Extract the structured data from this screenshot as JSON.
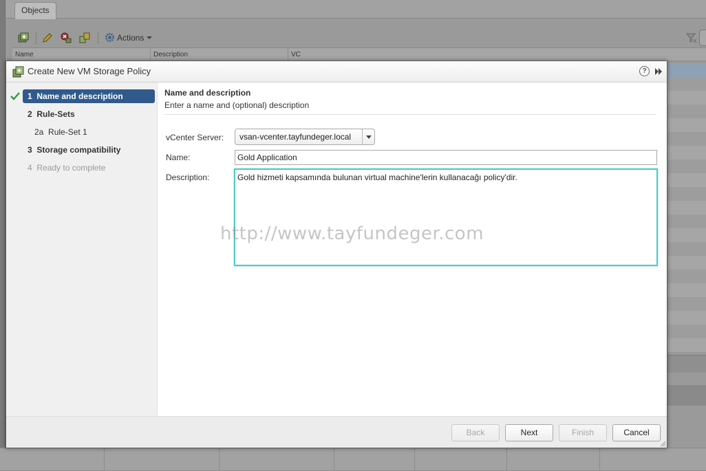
{
  "background": {
    "tab_label": "Objects",
    "toolbar": {
      "actions_label": "Actions"
    },
    "table_columns": [
      "Name",
      "Description",
      "VC"
    ]
  },
  "dialog": {
    "title": "Create New VM Storage Policy",
    "help_label": "?",
    "steps": [
      {
        "number": "1",
        "label": "Name and description",
        "state": "active"
      },
      {
        "number": "2",
        "label": "Rule-Sets",
        "state": "normal"
      },
      {
        "number": "2a",
        "label": "Rule-Set 1",
        "state": "sub"
      },
      {
        "number": "3",
        "label": "Storage compatibility",
        "state": "normal"
      },
      {
        "number": "4",
        "label": "Ready to complete",
        "state": "disabled"
      }
    ],
    "section_title": "Name and description",
    "section_subtitle": "Enter a name and (optional) description",
    "form": {
      "vcenter_label": "vCenter Server:",
      "vcenter_value": "vsan-vcenter.tayfundeger.local",
      "name_label": "Name:",
      "name_value": "Gold Application",
      "description_label": "Description:",
      "description_value": "Gold hizmeti kapsamında bulunan virtual machine'lerin kullanacağı policy'dir."
    },
    "watermark": "http://www.tayfundeger.com",
    "buttons": {
      "back": "Back",
      "next": "Next",
      "finish": "Finish",
      "cancel": "Cancel"
    }
  },
  "colors": {
    "active_step_bg": "#315a8c",
    "check_green": "#2e9c3a",
    "focus_border": "#4fcac6"
  }
}
